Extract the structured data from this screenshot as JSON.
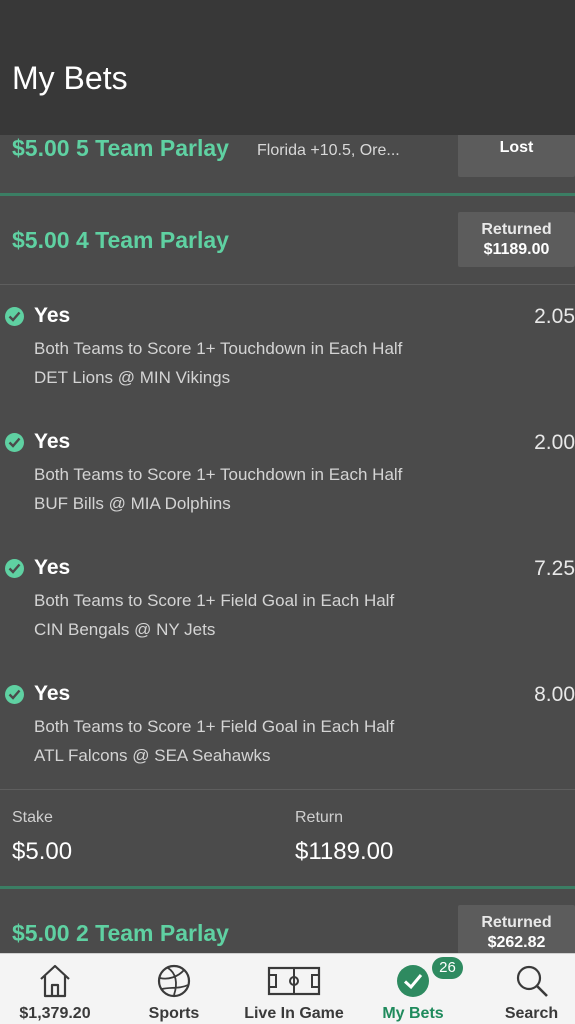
{
  "header": {
    "title": "My Bets"
  },
  "bets": [
    {
      "amount_title": "$5.00 5 Team Parlay",
      "description": "Florida +10.5, Ore...",
      "status": "Lost"
    },
    {
      "amount_title": "$5.00 4 Team Parlay",
      "status_line1": "Returned",
      "status_line2": "$1189.00",
      "selections": [
        {
          "pick": "Yes",
          "odds": "2.05",
          "market": "Both Teams to Score 1+ Touchdown in Each Half",
          "event": "DET Lions @ MIN Vikings"
        },
        {
          "pick": "Yes",
          "odds": "2.00",
          "market": "Both Teams to Score 1+ Touchdown in Each Half",
          "event": "BUF Bills @ MIA Dolphins"
        },
        {
          "pick": "Yes",
          "odds": "7.25",
          "market": "Both Teams to Score 1+ Field Goal in Each Half",
          "event": "CIN Bengals @ NY Jets"
        },
        {
          "pick": "Yes",
          "odds": "8.00",
          "market": "Both Teams to Score 1+ Field Goal in Each Half",
          "event": "ATL Falcons @ SEA Seahawks"
        }
      ],
      "stake_label": "Stake",
      "stake_value": "$5.00",
      "return_label": "Return",
      "return_value": "$1189.00"
    },
    {
      "amount_title": "$5.00 2 Team Parlay",
      "status_line1": "Returned",
      "status_line2": "$262.82"
    }
  ],
  "tabbar": {
    "tabs": [
      {
        "label": "$1,379.20",
        "icon": "home-icon"
      },
      {
        "label": "Sports",
        "icon": "ball-icon"
      },
      {
        "label": "Live In Game",
        "icon": "field-icon"
      },
      {
        "label": "My Bets",
        "icon": "check-circle-icon"
      },
      {
        "label": "Search",
        "icon": "search-icon"
      }
    ],
    "my_bets_count": "26"
  },
  "colors": {
    "accent_green": "#5fd1a2",
    "active_tab_green": "#1f8a5c",
    "header_bg": "#383838",
    "content_bg": "#4b4b4b"
  }
}
